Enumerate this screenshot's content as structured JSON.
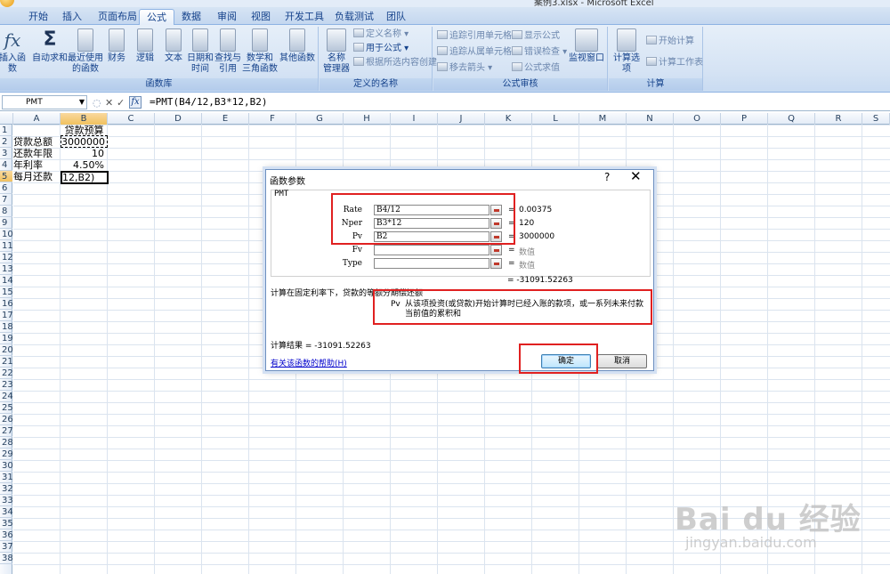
{
  "window": {
    "title": "案例3.xlsx - Microsoft Excel"
  },
  "tabs": [
    "开始",
    "插入",
    "页面布局",
    "公式",
    "数据",
    "审阅",
    "视图",
    "开发工具",
    "负载测试",
    "团队"
  ],
  "ribbon": {
    "function_library": {
      "label": "函数库",
      "insert_function": "插入函数",
      "autosum": "自动求和",
      "recent": [
        "最近使用",
        "的函数"
      ],
      "financial": "财务",
      "logical": "逻辑",
      "text": "文本",
      "datetime": [
        "日期和",
        "时间"
      ],
      "lookup": [
        "查找与",
        "引用"
      ],
      "math": [
        "数学和",
        "三角函数"
      ],
      "more": "其他函数"
    },
    "defined_names": {
      "label": "定义的名称",
      "name_manager": [
        "名称",
        "管理器"
      ],
      "define_name": "定义名称",
      "use_in_formula": "用于公式",
      "create_from_selection": "根据所选内容创建"
    },
    "formula_auditing": {
      "label": "公式审核",
      "trace_precedents": "追踪引用单元格",
      "trace_dependents": "追踪从属单元格",
      "remove_arrows": "移去箭头",
      "show_formulas": "显示公式",
      "error_checking": "错误检查",
      "evaluate_formula": "公式求值",
      "watch_window": "监视窗口"
    },
    "calculation": {
      "label": "计算",
      "calc_options": "计算选项",
      "calc_now": "开始计算",
      "calc_sheet": "计算工作表"
    }
  },
  "formula_bar": {
    "name_box": "PMT",
    "cancel_icon": "✕",
    "enter_icon": "✓",
    "fx": "fx",
    "formula": "=PMT(B4/12,B3*12,B2)"
  },
  "columns": [
    "A",
    "B",
    "C",
    "D",
    "E",
    "F",
    "G",
    "H",
    "I",
    "J",
    "K",
    "L",
    "M",
    "N",
    "O",
    "P",
    "Q",
    "R",
    "S"
  ],
  "rows": [
    "1",
    "2",
    "3",
    "4",
    "5",
    "6",
    "7",
    "8",
    "9",
    "10",
    "11",
    "12",
    "13",
    "14",
    "15",
    "16",
    "17",
    "18",
    "19",
    "20",
    "21",
    "22",
    "23",
    "24",
    "25",
    "26",
    "27",
    "28",
    "29",
    "30",
    "31",
    "32",
    "33",
    "34",
    "35",
    "36",
    "37",
    "38"
  ],
  "cells": {
    "B1": "贷款预算",
    "A2": "贷款总额",
    "B2": "3000000",
    "A3": "还款年限",
    "B3": "10",
    "A4": "年利率",
    "B4": "4.50%",
    "A5": "每月还款",
    "B5": "12,B2)"
  },
  "dialog": {
    "title": "函数参数",
    "help": "?",
    "close": "✕",
    "function": "PMT",
    "args": [
      {
        "label": "Rate",
        "input": "B4/12",
        "result": "0.00375",
        "dim": false
      },
      {
        "label": "Nper",
        "input": "B3*12",
        "result": "120",
        "dim": false
      },
      {
        "label": "Pv",
        "input": "B2",
        "result": "3000000",
        "dim": false
      },
      {
        "label": "Fv",
        "input": "",
        "result": "数值",
        "dim": true
      },
      {
        "label": "Type",
        "input": "",
        "result": "数值",
        "dim": true
      }
    ],
    "eq": "=",
    "result_line": "= -31091.52263",
    "description": "计算在固定利率下，贷款的等额分期偿还额",
    "arg_help_name": "Pv",
    "arg_help_text": "从该项投资(或贷款)开始计算时已经入账的款项，或一系列未来付款当前值的累积和",
    "calc_result": "计算结果 = -31091.52263",
    "help_link": "有关该函数的帮助(H)",
    "ok": "确定",
    "cancel": "取消"
  },
  "watermark": {
    "logo": "Bai du 经验",
    "url": "jingyan.baidu.com"
  },
  "colors": {
    "annotation": "#e02020",
    "ribbon_text": "#15428b",
    "header_selected": "#f1c15f"
  }
}
